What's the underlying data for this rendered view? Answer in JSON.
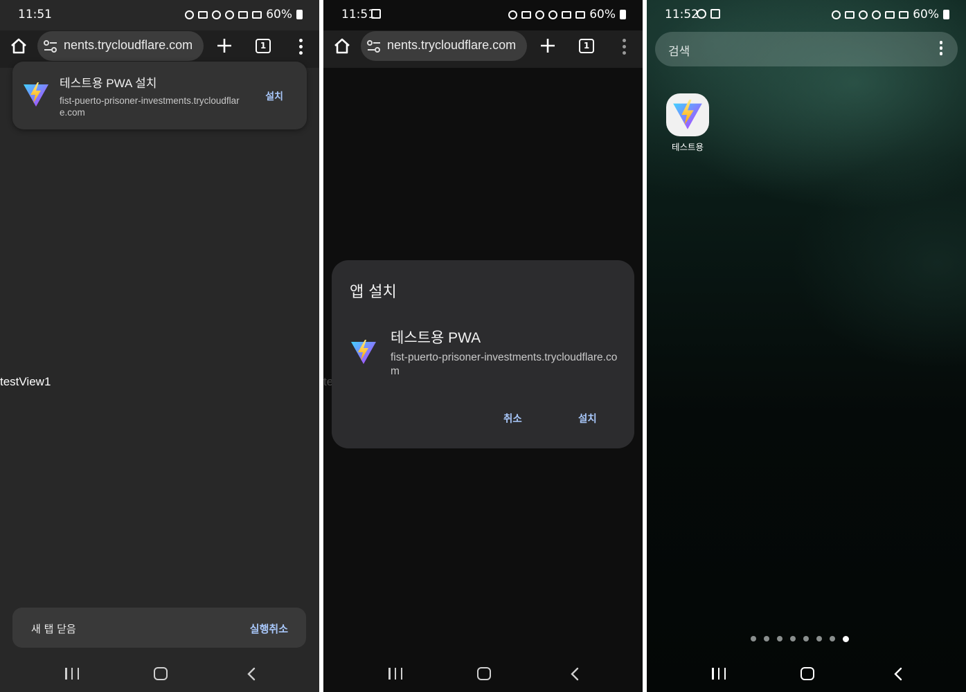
{
  "panel1": {
    "status": {
      "time": "11:51",
      "battery": "60%"
    },
    "omnibox": {
      "url": "nents.trycloudflare.com",
      "tab_count": "1"
    },
    "install_banner": {
      "title": "테스트용 PWA 설치",
      "url": "fist-puerto-prisoner-investments.trycloudflare.com",
      "install_label": "설치"
    },
    "page_text": "testView1",
    "snackbar": {
      "message": "새 탭 닫음",
      "action": "실행취소"
    }
  },
  "panel2": {
    "status": {
      "time": "11:51",
      "battery": "60%"
    },
    "omnibox": {
      "url": "nents.trycloudflare.com",
      "tab_count": "1"
    },
    "partial_text": "te",
    "dialog": {
      "title": "앱 설치",
      "app_name": "테스트용 PWA",
      "url": "fist-puerto-prisoner-investments.trycloudflare.com",
      "cancel_label": "취소",
      "install_label": "설치"
    }
  },
  "panel3": {
    "status": {
      "time": "11:52",
      "battery": "60%"
    },
    "search_placeholder": "검색",
    "app_label": "테스트용",
    "page_count": 8,
    "active_page": 8
  },
  "icons": [
    "home-icon",
    "site-settings-icon",
    "new-tab-icon",
    "tab-switcher-icon",
    "more-menu-icon",
    "vite-app-icon",
    "recents-icon",
    "nav-home-icon",
    "back-icon",
    "alarm-icon",
    "mute-icon",
    "hotspot-icon",
    "wifi-icon",
    "hd-voice-icon",
    "signal-icon",
    "battery-icon",
    "gallery-icon"
  ],
  "colors": {
    "accent": "#a8c7fa",
    "chrome_toolbar": "#1f1f1f",
    "omnibox": "#3c3c3c",
    "dialog": "#2c2c2e"
  }
}
